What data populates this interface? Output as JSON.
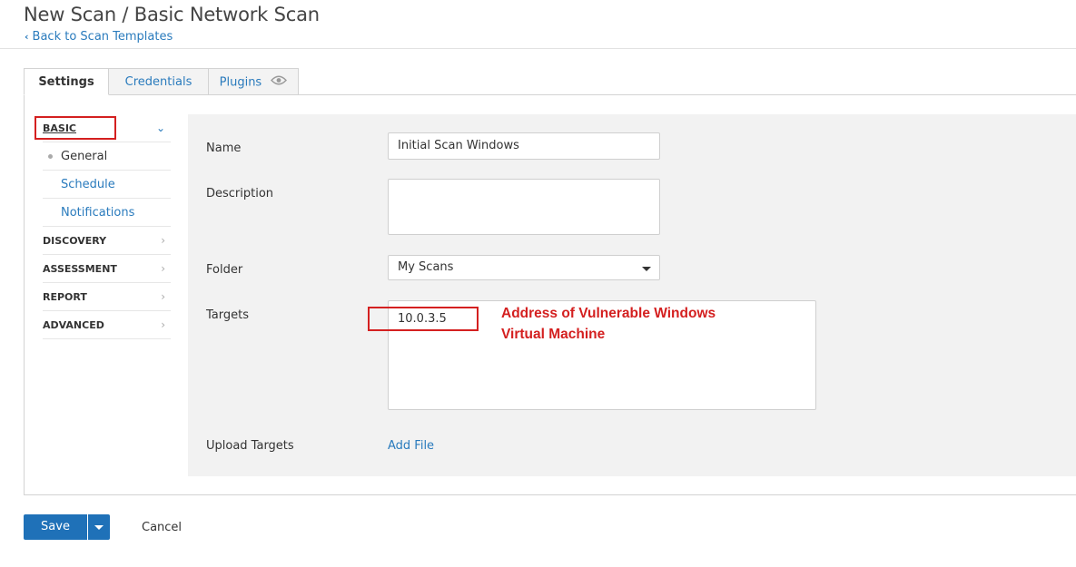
{
  "header": {
    "title": "New Scan / Basic Network Scan",
    "back_link": "Back to Scan Templates"
  },
  "tabs": [
    {
      "label": "Settings",
      "active": true
    },
    {
      "label": "Credentials",
      "active": false
    },
    {
      "label": "Plugins",
      "active": false,
      "icon": "eye-icon"
    }
  ],
  "sidebar": {
    "sections": [
      {
        "label": "BASIC",
        "expanded": true
      },
      {
        "label": "DISCOVERY"
      },
      {
        "label": "ASSESSMENT"
      },
      {
        "label": "REPORT"
      },
      {
        "label": "ADVANCED"
      }
    ],
    "basic_items": [
      {
        "label": "General",
        "selected": true
      },
      {
        "label": "Schedule"
      },
      {
        "label": "Notifications"
      }
    ]
  },
  "form": {
    "name_label": "Name",
    "name_value": "Initial Scan Windows",
    "description_label": "Description",
    "description_value": "",
    "folder_label": "Folder",
    "folder_value": "My Scans",
    "targets_label": "Targets",
    "targets_value": "10.0.3.5",
    "upload_label": "Upload Targets",
    "upload_link": "Add File"
  },
  "annotation": {
    "line1": "Address of Vulnerable Windows",
    "line2": "Virtual Machine",
    "color": "#d42020"
  },
  "footer": {
    "save_label": "Save",
    "cancel_label": "Cancel"
  },
  "colors": {
    "accent": "#2a7bbd",
    "primary_button": "#1f71b8"
  }
}
